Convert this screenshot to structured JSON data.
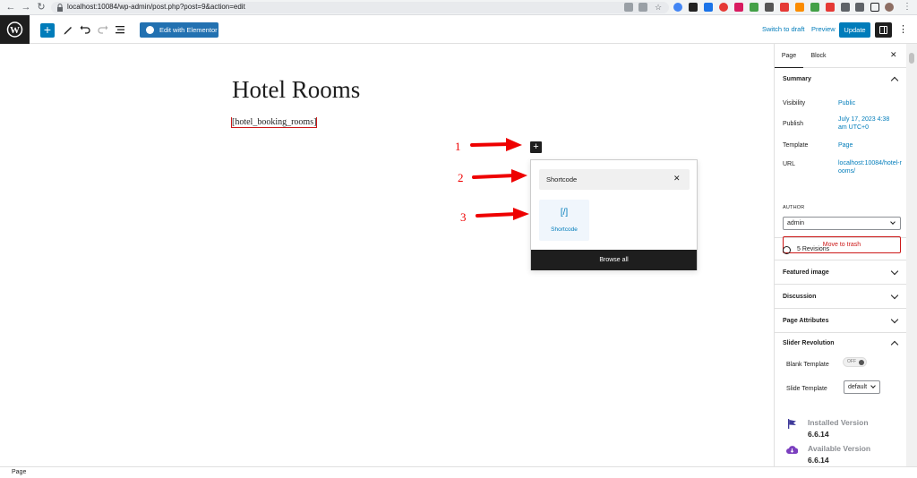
{
  "browser": {
    "url": "localhost:10084/wp-admin/post.php?post=9&action=edit"
  },
  "toolbar": {
    "edit_with_elementor": "Edit with Elementor",
    "switch_to_draft": "Switch to draft",
    "preview": "Preview",
    "update": "Update"
  },
  "editor": {
    "title": "Hotel Rooms",
    "shortcode": "[hotel_booking_rooms]"
  },
  "annotations": [
    "1",
    "2",
    "3"
  ],
  "inserter": {
    "search_value": "Shortcode",
    "result_icon": "[/]",
    "result_label": "Shortcode",
    "browse_all": "Browse all"
  },
  "sidebar": {
    "tabs": [
      "Page",
      "Block"
    ],
    "summary": {
      "heading": "Summary",
      "rows": [
        {
          "label": "Visibility",
          "value": "Public"
        },
        {
          "label": "Publish",
          "value": "July 17, 2023 4:38 am UTC+0"
        },
        {
          "label": "Template",
          "value": "Page"
        },
        {
          "label": "URL",
          "value": "localhost:10084/hotel-rooms/"
        }
      ],
      "author_label": "AUTHOR",
      "author_value": "admin",
      "move_to_trash": "Move to trash"
    },
    "revisions": "5 Revisions",
    "panels": [
      "Featured image",
      "Discussion",
      "Page Attributes"
    ],
    "slider_revolution": {
      "heading": "Slider Revolution",
      "blank_template_label": "Blank Template",
      "blank_template_toggle": "OFF",
      "slide_template_label": "Slide Template",
      "slide_template_value": "default",
      "installed_label": "Installed Version",
      "installed_value": "6.6.14",
      "available_label": "Available Version",
      "available_value": "6.6.14"
    }
  },
  "footer": {
    "breadcrumb": "Page"
  },
  "colors": {
    "wp_blue": "#007cba",
    "annotation_red": "#e00000",
    "trash_red": "#cc1818",
    "dark": "#1e1e1e"
  }
}
